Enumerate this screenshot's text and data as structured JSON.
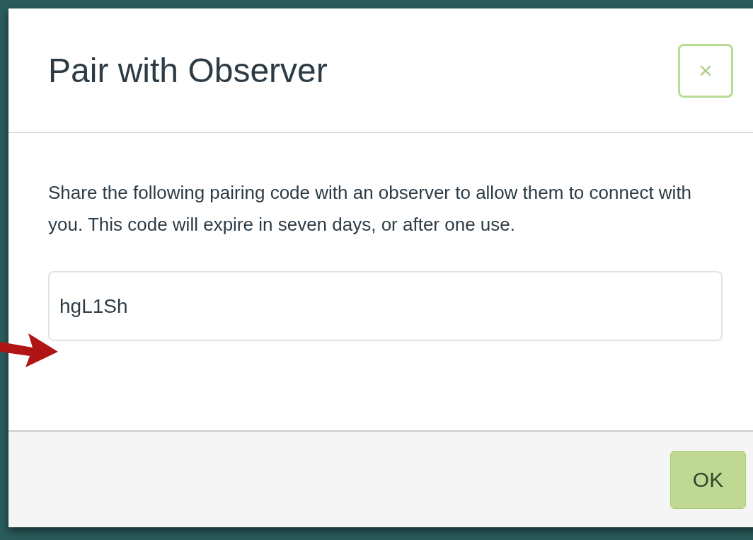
{
  "dialog": {
    "title": "Pair with Observer",
    "close_icon": "×",
    "message": "Share the following pairing code with an observer to allow them to connect with you. This code will expire in seven days, or after one use.",
    "pairing_code": "hgL1Sh",
    "buttons": [
      "OK"
    ]
  }
}
